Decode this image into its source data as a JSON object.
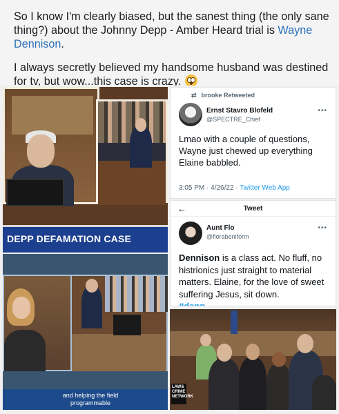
{
  "post": {
    "paragraph1_text": "So I know I'm clearly biased, but the sanest thing (the only sane thing?) about the Johnny Depp - Amber Heard trial is",
    "paragraph1_link": "Wayne Dennison",
    "paragraph1_end": ".",
    "paragraph2_text": "I always secretly believed my handsome husband was destined for tv, but wow...this case is crazy.",
    "emoji": "flushed-face-icon"
  },
  "tile_broadcast": {
    "banner_text": "DEPP DEFAMATION CASE"
  },
  "tweet1": {
    "retweeted_by": "brooke Retweeted",
    "name": "Ernst Stavro Blofeld",
    "handle": "@SPECTRE_Chief",
    "more": "•••",
    "body": "Lmao with a couple of questions, Wayne just chewed up everything Elaine babbled.",
    "timestamp": "3:05 PM · 4/26/22 · ",
    "source": "Twitter Web App"
  },
  "tweet2": {
    "back": "←",
    "header": "Tweet",
    "name": "Aunt Flo",
    "handle": "@florabeniform",
    "more": "•••",
    "body_bold": "Dennison",
    "body_rest": " is a class act. No fluff, no histrionics just straight to material matters. Elaine, for the love of sweet suffering Jesus, sit down.",
    "hashtag": "#depp"
  },
  "tile_monitors": {
    "caption": "and helping the field programmable"
  },
  "tile_group": {
    "logo_text": "LAW& CRIME NETWORK"
  }
}
